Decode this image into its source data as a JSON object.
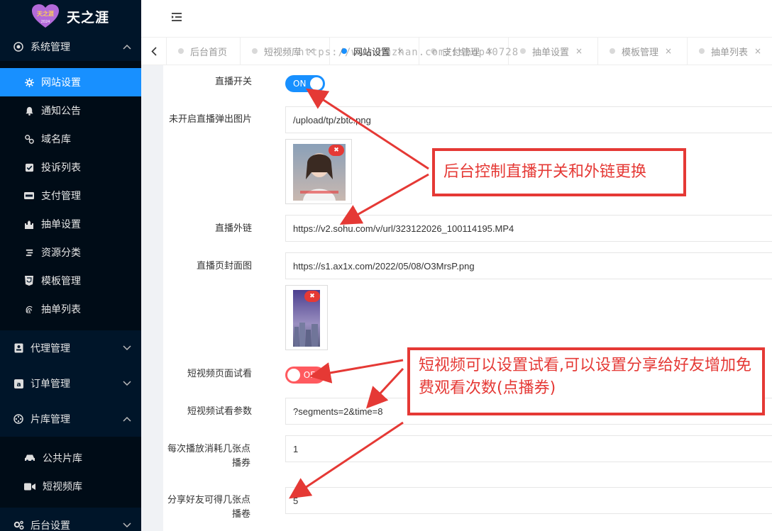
{
  "app": {
    "logo_text": "天之涯",
    "logo_badge_text": "天之涯",
    "logo_badge_sub": "2024"
  },
  "sidebar": {
    "group_system": "系统管理",
    "items": [
      {
        "label": "网站设置",
        "icon": "gear-icon"
      },
      {
        "label": "通知公告",
        "icon": "bell-icon"
      },
      {
        "label": "域名库",
        "icon": "link-icon"
      },
      {
        "label": "投诉列表",
        "icon": "checkbox-icon"
      },
      {
        "label": "支付管理",
        "icon": "paypal-icon"
      },
      {
        "label": "抽单设置",
        "icon": "castle-icon"
      },
      {
        "label": "资源分类",
        "icon": "category-icon"
      },
      {
        "label": "模板管理",
        "icon": "html5-icon"
      },
      {
        "label": "抽单列表",
        "icon": "fingerprint-icon"
      }
    ],
    "group_agent": "代理管理",
    "group_order": "订单管理",
    "group_library": "片库管理",
    "library_items": [
      {
        "label": "公共片库",
        "icon": "car-icon"
      },
      {
        "label": "短视频库",
        "icon": "video-icon"
      }
    ],
    "group_backend": "后台设置"
  },
  "tabs": [
    {
      "label": "后台首页",
      "active": false
    },
    {
      "label": "短视频库",
      "active": false
    },
    {
      "label": "网站设置",
      "active": true
    },
    {
      "label": "支付管理",
      "active": false
    },
    {
      "label": "抽单设置",
      "active": false
    },
    {
      "label": "模板管理",
      "active": false
    },
    {
      "label": "抽单列表",
      "active": false
    }
  ],
  "tab_close_glyph": "×",
  "watermark": "https://www.huzhan.com/ishop40728",
  "form": {
    "live_switch_label": "直播开关",
    "live_switch_text": "ON",
    "live_popup_label": "未开启直播弹出图片",
    "live_popup_value": "/upload/tp/zbtc.png",
    "live_link_label": "直播外链",
    "live_link_value": "https://v2.sohu.com/v/url/323122026_100114195.MP4",
    "live_cover_label": "直播页封面图",
    "live_cover_value": "https://s1.ax1x.com/2022/05/08/O3MrsP.png",
    "trial_switch_label": "短视频页面试看",
    "trial_switch_text": "OFF",
    "trial_param_label": "短视频试看参数",
    "trial_param_value": "?segments=2&time=8",
    "cost_label": "每次播放消耗几张点播券",
    "cost_value": "1",
    "share_label": "分享好友可得几张点播卷",
    "share_value": "5"
  },
  "annotations": {
    "callout_1": "后台控制直播开关和外链更换",
    "callout_2": "短视频可以设置试看,可以设置分享给好友增加免费观看次数(点播券)"
  },
  "colors": {
    "sidebar_bg": "#001529",
    "active_blue": "#1890ff",
    "annotation_red": "#e53935",
    "switch_off": "#ff5a5f"
  }
}
